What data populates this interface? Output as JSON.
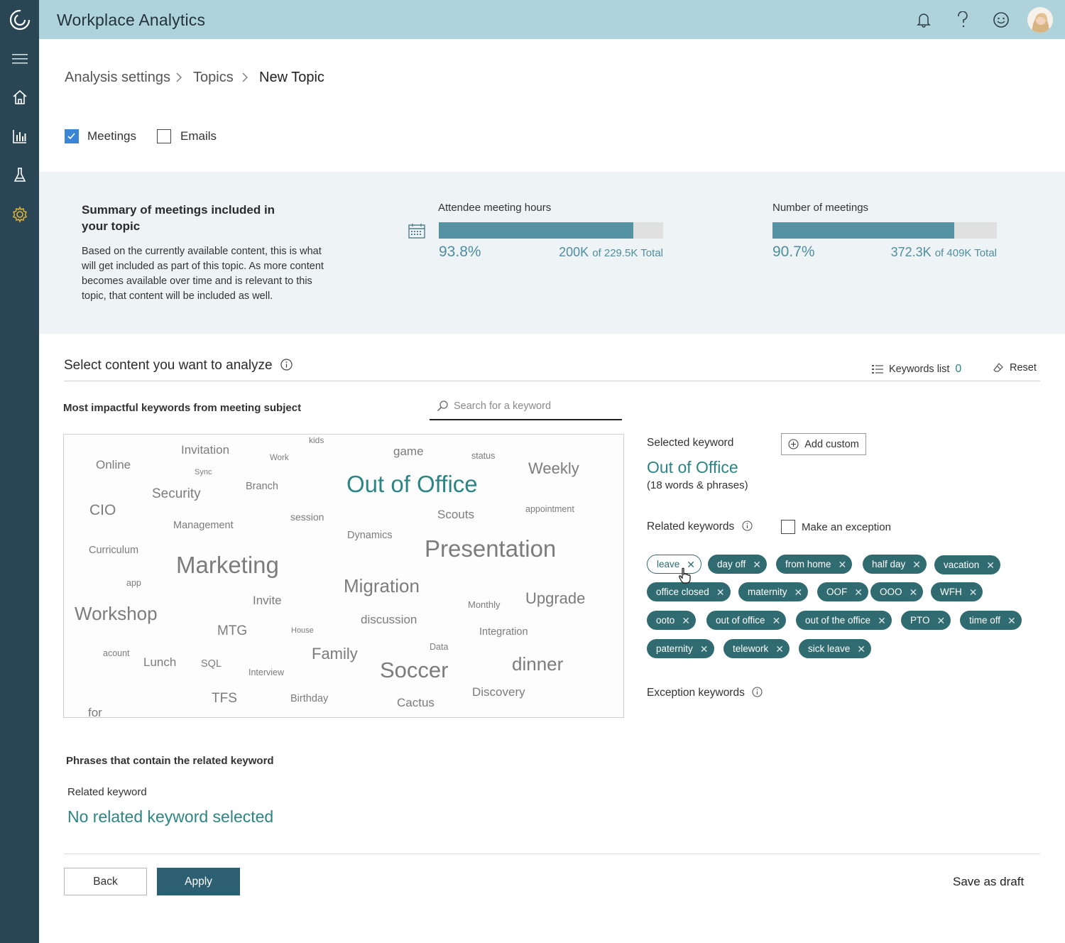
{
  "app": {
    "title": "Workplace Analytics"
  },
  "icons": {
    "logo": "logo-icon",
    "menu": "hamburger-icon",
    "home": "home-icon",
    "reports": "bar-chart-icon",
    "explore": "flask-icon",
    "settings": "gear-icon",
    "bell": "bell-icon",
    "help": "help-icon",
    "feedback": "smiley-icon",
    "calendar": "calendar-icon",
    "info": "info-icon",
    "list": "list-icon",
    "eraser": "eraser-icon",
    "search": "search-icon",
    "plus": "plus-circle-icon"
  },
  "colors": {
    "rail": "#2a4654",
    "topbar": "#afd3da",
    "accent": "#2c8584",
    "pill": "#2f6b70",
    "primary_button": "#2d5f73",
    "active_nav": "#e0b33a"
  },
  "breadcrumb": {
    "items": [
      "Analysis settings",
      "Topics",
      "New Topic"
    ]
  },
  "filters": {
    "meetings": {
      "label": "Meetings",
      "checked": true
    },
    "emails": {
      "label": "Emails",
      "checked": false
    }
  },
  "summary": {
    "title": "Summary of meetings included in your topic",
    "description": "Based on the currently available content, this is what will get included as part of this topic. As more content becomes available over time and is relevant to this topic, that content will be included as well.",
    "hours": {
      "title": "Attendee meeting hours",
      "percent_label": "93.8%",
      "fraction": 0.867,
      "value": "200K",
      "of_total": "of 229.5K Total"
    },
    "meetings": {
      "title": "Number of meetings",
      "percent_label": "90.7%",
      "fraction": 0.81,
      "value": "372.3K",
      "of_total": "of 409K Total"
    }
  },
  "content": {
    "title": "Select content you want to analyze",
    "keywords_list_label": "Keywords list",
    "keywords_list_count": "0",
    "reset_label": "Reset",
    "cloud_title": "Most impactful keywords from meeting subject",
    "search_placeholder": "Search for a keyword",
    "cloud_words": [
      "Invitation",
      "kids",
      "game",
      "status",
      "Online",
      "Work",
      "Sync",
      "Weekly",
      "Security",
      "Branch",
      "Out of Office",
      "CIO",
      "session",
      "Scouts",
      "appointment",
      "Management",
      "Dynamics",
      "Curriculum",
      "Presentation",
      "Marketing",
      "app",
      "Migration",
      "Invite",
      "Monthly",
      "Upgrade",
      "Workshop",
      "discussion",
      "MTG",
      "House",
      "Integration",
      "acount",
      "Data",
      "Lunch",
      "SQL",
      "Family",
      "Interview",
      "Soccer",
      "dinner",
      "TFS",
      "Birthday",
      "Discovery",
      "Cactus",
      "for"
    ]
  },
  "selected": {
    "label": "Selected keyword",
    "add_custom": "Add custom",
    "keyword": "Out of Office",
    "count": "(18 words & phrases)",
    "related_label": "Related keywords",
    "exception_checkbox": "Make an exception",
    "related": [
      "leave",
      "day off",
      "from home",
      "half day",
      "vacation",
      "office closed",
      "maternity",
      "OOF",
      "OOO",
      "WFH",
      "ooto",
      "out of office",
      "out of the office",
      "PTO",
      "time off",
      "paternity",
      "telework",
      "sick leave"
    ],
    "exception_label": "Exception keywords"
  },
  "phrases": {
    "title": "Phrases that contain the related keyword",
    "related_label": "Related keyword",
    "empty": "No related keyword selected"
  },
  "actions": {
    "back": "Back",
    "apply": "Apply",
    "draft": "Save as draft"
  }
}
